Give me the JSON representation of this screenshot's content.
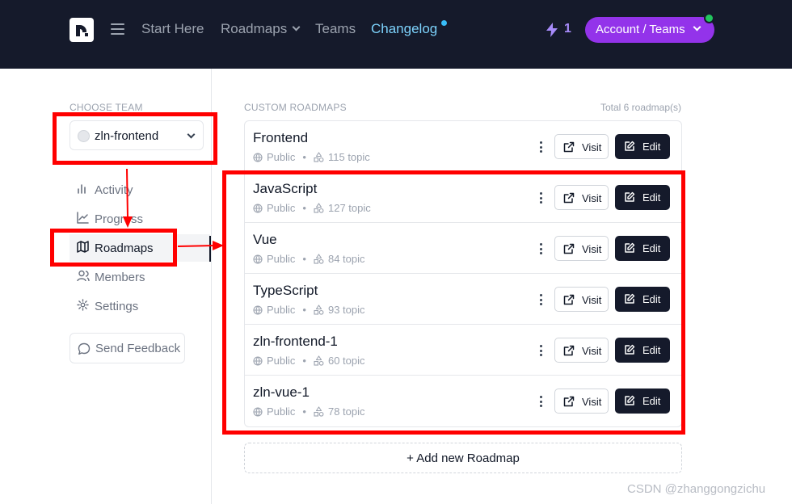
{
  "nav": {
    "links": [
      "Start Here",
      "Roadmaps",
      "Teams",
      "Changelog"
    ],
    "streak_count": "1",
    "account_button": "Account / Teams"
  },
  "sidebar": {
    "choose_team_label": "CHOOSE TEAM",
    "team_name": "zln-frontend",
    "items": [
      "Activity",
      "Progress",
      "Roadmaps",
      "Members",
      "Settings"
    ],
    "active_item": "Roadmaps",
    "feedback_label": "Send Feedback"
  },
  "main": {
    "section_label": "CUSTOM ROADMAPS",
    "total_label": "Total 6 roadmap(s)",
    "roadmaps": [
      {
        "title": "Frontend",
        "visibility": "Public",
        "topics": "115 topic"
      },
      {
        "title": "JavaScript",
        "visibility": "Public",
        "topics": "127 topic"
      },
      {
        "title": "Vue",
        "visibility": "Public",
        "topics": "84 topic"
      },
      {
        "title": "TypeScript",
        "visibility": "Public",
        "topics": "93 topic"
      },
      {
        "title": "zln-frontend-1",
        "visibility": "Public",
        "topics": "60 topic"
      },
      {
        "title": "zln-vue-1",
        "visibility": "Public",
        "topics": "78 topic"
      }
    ],
    "visit_label": "Visit",
    "edit_label": "Edit",
    "add_label": "+ Add new Roadmap"
  },
  "colors": {
    "nav_bg": "#151a2b",
    "accent_purple": "#9333ea",
    "changelog_blue": "#7dd3fc",
    "annotation_red": "#ff0000"
  },
  "icons": {
    "logo": "roadmap-logo-icon",
    "menu": "hamburger-icon",
    "streak": "lightning-bolt-icon",
    "activity": "bar-chart-icon",
    "progress": "line-chart-icon",
    "roadmaps": "map-icon",
    "members": "users-icon",
    "settings": "gear-icon",
    "feedback": "chat-bubble-icon",
    "visibility": "globe-icon",
    "topics": "shapes-icon",
    "visit": "external-link-icon",
    "edit": "pencil-square-icon",
    "more": "kebab-icon"
  },
  "watermark": "CSDN @zhanggongzichu"
}
